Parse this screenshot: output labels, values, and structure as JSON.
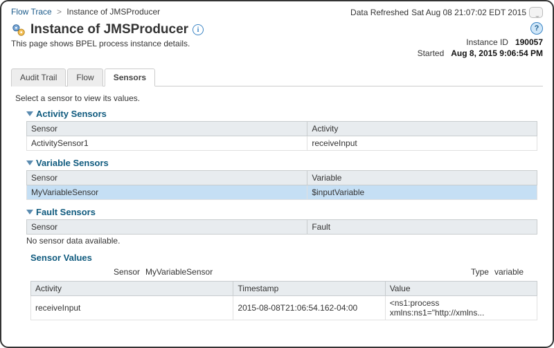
{
  "breadcrumb": {
    "root": "Flow Trace",
    "current": "Instance of JMSProducer"
  },
  "refresh": {
    "label": "Data Refreshed",
    "value": "Sat Aug 08 21:07:02 EDT 2015"
  },
  "title": "Instance of JMSProducer",
  "subtitle": "This page shows BPEL process instance details.",
  "meta": {
    "instanceId": {
      "label": "Instance ID",
      "value": "190057"
    },
    "started": {
      "label": "Started",
      "value": "Aug 8, 2015 9:06:54 PM"
    }
  },
  "tabs": [
    {
      "label": "Audit Trail"
    },
    {
      "label": "Flow"
    },
    {
      "label": "Sensors"
    }
  ],
  "instructions": "Select a sensor to view its values.",
  "activitySensors": {
    "title": "Activity Sensors",
    "col1": "Sensor",
    "col2": "Activity",
    "rows": [
      {
        "c1": "ActivitySensor1",
        "c2": "receiveInput"
      }
    ]
  },
  "variableSensors": {
    "title": "Variable Sensors",
    "col1": "Sensor",
    "col2": "Variable",
    "rows": [
      {
        "c1": "MyVariableSensor",
        "c2": "$inputVariable"
      }
    ]
  },
  "faultSensors": {
    "title": "Fault Sensors",
    "col1": "Sensor",
    "col2": "Fault",
    "nodata": "No sensor data available."
  },
  "sensorValues": {
    "title": "Sensor Values",
    "sensorLabel": "Sensor",
    "sensorValue": "MyVariableSensor",
    "typeLabel": "Type",
    "typeValue": "variable",
    "col1": "Activity",
    "col2": "Timestamp",
    "col3": "Value",
    "rows": [
      {
        "c1": "receiveInput",
        "c2": "2015-08-08T21:06:54.162-04:00",
        "c3": "<ns1:process xmlns:ns1=\"http://xmlns..."
      }
    ]
  }
}
